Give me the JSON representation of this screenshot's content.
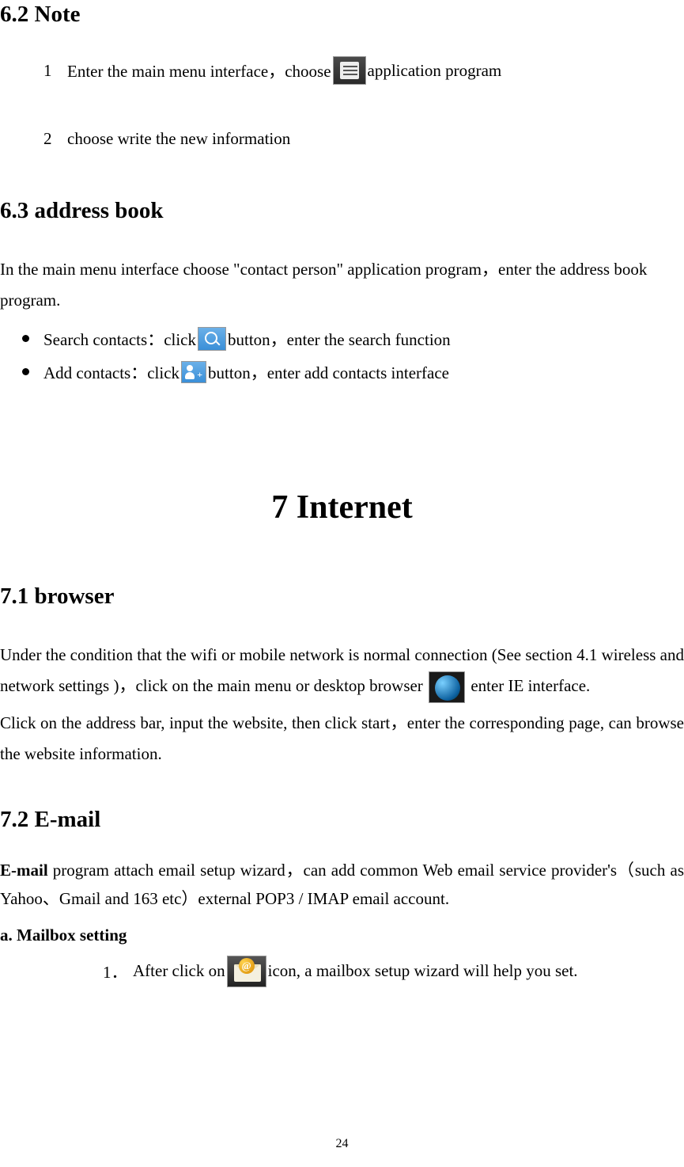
{
  "sections": {
    "s62": {
      "heading": "6.2 Note",
      "items": [
        {
          "num": "1",
          "pre": "Enter the main menu interface，choose",
          "post": "application program"
        },
        {
          "num": "2",
          "text": "choose write the new information"
        }
      ]
    },
    "s63": {
      "heading": "6.3 address book",
      "intro": "In the main menu interface choose \"contact person\" application program，enter the address book program.",
      "bullets": [
        {
          "pre": "Search contacts：click",
          "post": "button，enter the search function"
        },
        {
          "pre": "Add contacts：click",
          "post": "button，enter add contacts interface"
        }
      ]
    },
    "ch7": {
      "heading": "7  Internet"
    },
    "s71": {
      "heading": "7.1 browser",
      "line1_pre": "Under the condition that the wifi or mobile network is normal connection (See section 4.1 wireless and network settings )，click on the main menu or desktop browser",
      "line1_post": "enter IE interface.",
      "line2": "Click on the address bar, input the website, then click start，enter the corresponding page, can browse the website information."
    },
    "s72": {
      "heading": "7.2  E-mail",
      "para_lead": "E-mail",
      "para_rest": " program attach email setup wizard，can add common Web email service provider's（such as Yahoo、Gmail and 163 etc）external POP3 / IMAP email account.",
      "sub_heading": "a.  Mailbox setting",
      "step1_num": "1．",
      "step1_pre": "After click on",
      "step1_post": "icon, a mailbox setup wizard will help you set."
    }
  },
  "page_number": "24"
}
